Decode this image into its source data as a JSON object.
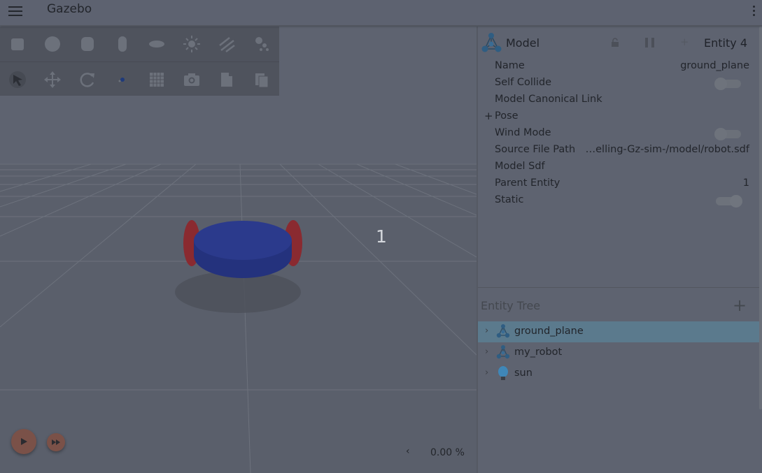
{
  "app": {
    "title": "Gazebo"
  },
  "viewport": {
    "toolbar_row1": [
      {
        "name": "box-shape-icon"
      },
      {
        "name": "sphere-shape-icon"
      },
      {
        "name": "cylinder-shape-icon"
      },
      {
        "name": "capsule-shape-icon"
      },
      {
        "name": "ellipsoid-shape-icon"
      },
      {
        "name": "point-light-icon"
      },
      {
        "name": "directional-light-icon"
      },
      {
        "name": "spot-light-icon"
      }
    ],
    "toolbar_row2": [
      {
        "name": "select-mode-icon"
      },
      {
        "name": "translate-mode-icon"
      },
      {
        "name": "rotate-mode-icon"
      },
      {
        "name": "transform-settings-icon"
      },
      {
        "name": "grid-config-icon"
      },
      {
        "name": "screenshot-icon"
      },
      {
        "name": "copy-icon"
      },
      {
        "name": "paste-icon"
      }
    ],
    "entity_label": "1",
    "real_time_factor": "0.00 %",
    "rtf_chevron": "‹"
  },
  "component_inspector": {
    "type_label": "Model",
    "entity_id": "Entity 4",
    "plus_symbol": "+",
    "properties": [
      {
        "label": "Name",
        "value": "ground_plane"
      },
      {
        "label": "Self Collide",
        "toggle": false
      },
      {
        "label": "Model Canonical Link",
        "value": ""
      },
      {
        "label": "Pose",
        "expandable": true,
        "expand_symbol": "+"
      },
      {
        "label": "Wind Mode",
        "toggle": false
      },
      {
        "label": "Source File Path",
        "value": "…elling-Gz-sim-/model/robot.sdf"
      },
      {
        "label": "Model Sdf",
        "value": ""
      },
      {
        "label": "Parent Entity",
        "value": "1"
      },
      {
        "label": "Static",
        "toggle": true
      }
    ]
  },
  "entity_tree": {
    "title": "Entity Tree",
    "add_symbol": "+",
    "chevron": "›",
    "items": [
      {
        "label": "ground_plane",
        "icon": "model-icon",
        "selected": true
      },
      {
        "label": "my_robot",
        "icon": "model-icon",
        "selected": false
      },
      {
        "label": "sun",
        "icon": "light-bulb-icon",
        "selected": false
      }
    ]
  },
  "colors": {
    "accent_selected": "#5b7a8d",
    "play_button": "#7a5148",
    "robot_body": "#2b3a8c",
    "robot_wheels": "#8a2a30"
  }
}
